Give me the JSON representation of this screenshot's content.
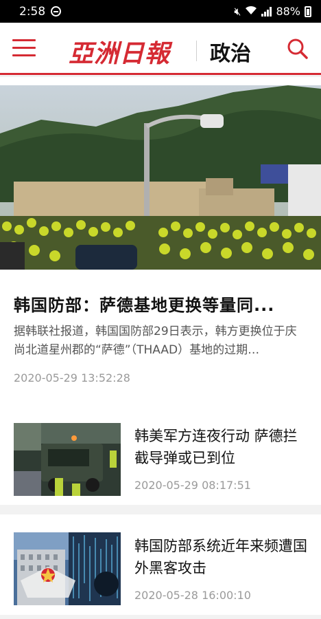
{
  "status_bar": {
    "time": "2:58",
    "battery": "88%"
  },
  "header": {
    "logo": "亞洲日報",
    "section": "政治"
  },
  "hero": {
    "title": "韩国防部：萨德基地更换等量同...",
    "summary": "据韩联社报道，韩国国防部29日表示，韩方更换位于庆尚北道星州郡的“萨德”（THAAD）基地的过期…",
    "date": "2020-05-29 13:52:28"
  },
  "articles": [
    {
      "title": "韩美军方连夜行动 萨德拦截导弹或已到位",
      "date": "2020-05-29 08:17:51"
    },
    {
      "title": "韩国防部系统近年来频遭国外黑客攻击",
      "date": "2020-05-28 16:00:10"
    }
  ],
  "colors": {
    "brand_red": "#d52a33",
    "status_bar": "#000000",
    "date_gray": "#9a9a9a"
  },
  "icons": [
    "menu-icon",
    "search-icon",
    "do-not-disturb-icon",
    "mute-icon",
    "wifi-icon",
    "signal-icon",
    "battery-icon"
  ]
}
